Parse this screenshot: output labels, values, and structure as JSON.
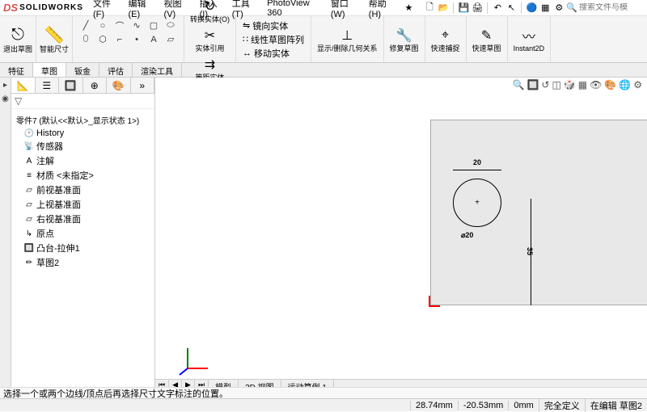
{
  "app": {
    "logo_text": "SOLIDWORKS"
  },
  "menu": [
    "文件(F)",
    "编辑(E)",
    "视图(V)",
    "插入(I)",
    "工具(T)",
    "PhotoView 360",
    "窗口(W)",
    "帮助(H)"
  ],
  "search": {
    "placeholder": "搜索文件与模"
  },
  "ribbon": {
    "exit_sketch": "退出草图",
    "smart_dim": "智能尺寸",
    "groups": {
      "cut_extrude": "转换实体(O)",
      "trim": "实体引用",
      "offset": "等距实体",
      "mirror": "镜向实体",
      "linear_pattern": "线性草图阵列",
      "move": "移动实体",
      "display_delete": "显示/删除几何关系",
      "repair": "修复草图",
      "quick_snap": "快速捕捉",
      "rapid_sketch": "快速草图",
      "instant2d": "Instant2D"
    }
  },
  "tabs": [
    "特征",
    "草图",
    "钣金",
    "评估",
    "渲染工具"
  ],
  "active_tab": "草图",
  "side_tabs_icons": [
    "📐",
    "☰",
    "🔲",
    "⊕",
    "🎨"
  ],
  "tree": {
    "root": "零件7 (默认<<默认>_显示状态 1>)",
    "items": [
      {
        "icon": "🕑",
        "label": "History"
      },
      {
        "icon": "📡",
        "label": "传感器"
      },
      {
        "icon": "A",
        "label": "注解"
      },
      {
        "icon": "≡",
        "label": "材质 <未指定>"
      },
      {
        "icon": "▱",
        "label": "前视基准面"
      },
      {
        "icon": "▱",
        "label": "上视基准面"
      },
      {
        "icon": "▱",
        "label": "右视基准面"
      },
      {
        "icon": "↳",
        "label": "原点"
      },
      {
        "icon": "🔲",
        "label": "凸台-拉伸1"
      },
      {
        "icon": "✏",
        "label": "草图2"
      }
    ]
  },
  "chart_data": {
    "type": "sketch",
    "dim_horizontal": "20",
    "dim_diameter": "⌀20",
    "dim_vertical": "35"
  },
  "bottom_tabs": [
    "模型",
    "3D 视图",
    "运动算例 1"
  ],
  "hint": "选择一个或两个边线/顶点后再选择尺寸文字标注的位置。",
  "status": {
    "x": "28.74mm",
    "y": "-20.53mm",
    "z": "0mm",
    "def": "完全定义",
    "mode": "在编辑 草图2"
  }
}
